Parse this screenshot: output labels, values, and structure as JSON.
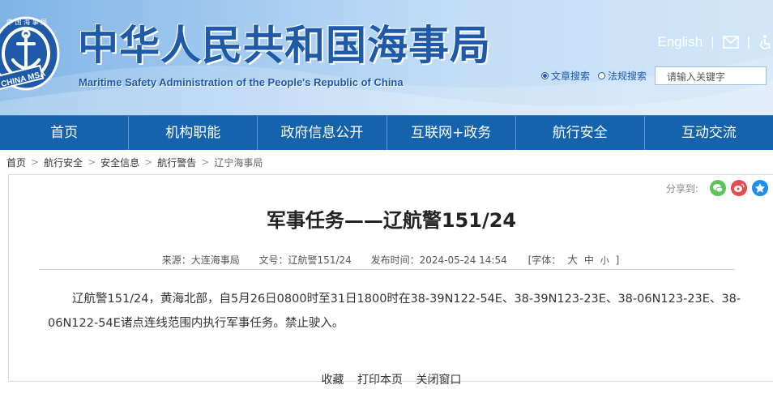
{
  "header": {
    "title": "中华人民共和国海事局",
    "subtitle": "Maritime Safety Administration of the People's Republic of China",
    "english_link": "English",
    "separator": "|",
    "search": {
      "option_article": "文章搜索",
      "option_law": "法规搜索",
      "placeholder": "请输入关键字"
    },
    "logo_text": {
      "top": "中 国 海 事 局",
      "bottom": "CHINA MSA"
    }
  },
  "nav": {
    "items": [
      "首页",
      "机构职能",
      "政府信息公开",
      "互联网+政务",
      "航行安全",
      "互动交流"
    ]
  },
  "breadcrumb": {
    "items": [
      "首页",
      "航行安全",
      "安全信息",
      "航行警告",
      "辽宁海事局"
    ],
    "arrow": ">"
  },
  "article": {
    "share_label": "分享到:",
    "title": "军事任务——辽航警151/24",
    "meta": {
      "source": "来源：大连海事局",
      "doc_no": "文号：辽航警151/24",
      "published": "发布时间：2024-05-24 14:54",
      "font_label": "[字体：",
      "font_large": "大",
      "font_medium": "中",
      "font_small": "小",
      "font_close": "]"
    },
    "body": "辽航警151/24，黄海北部，自5月26日0800时至31日1800时在38-39N122-54E、38-39N123-23E、38-06N123-23E、38-06N122-54E诸点连线范围内执行军事任务。禁止驶入。",
    "actions": {
      "favorite": "收藏",
      "print": "打印本页",
      "close": "关闭窗口"
    }
  },
  "colors": {
    "nav_bg": "#1463ac",
    "title_blue": "#1f5aa8"
  }
}
